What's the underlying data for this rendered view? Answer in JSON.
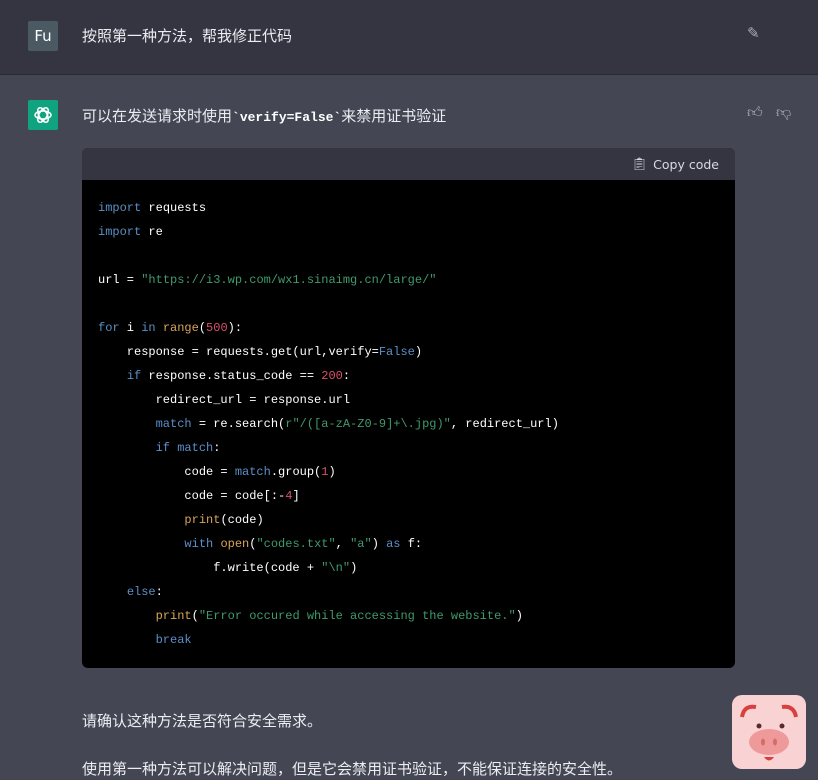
{
  "user": {
    "avatar": "Fu",
    "message": "按照第一种方法，帮我修正代码",
    "edit_icon": "edit-icon"
  },
  "assistant": {
    "intro_before": "可以在发送请求时使用",
    "intro_code": "`verify=False`",
    "intro_after": "来禁用证书验证",
    "thumbs_up": "thumbs-up-icon",
    "thumbs_down": "thumbs-down-icon",
    "para1": "请确认这种方法是否符合安全需求。",
    "para2": "使用第一种方法可以解决问题，但是它会禁用证书验证，不能保证连接的安全性。"
  },
  "code": {
    "copy_label": "Copy code",
    "colors": {
      "keyword": "#5b8fc7",
      "builtin": "#d8a55a",
      "number": "#d9506b",
      "string": "#3f9a6e"
    },
    "lines": [
      [
        [
          "k",
          "import"
        ],
        [
          "p",
          " requests"
        ]
      ],
      [
        [
          "k",
          "import"
        ],
        [
          "p",
          " re"
        ]
      ],
      [],
      [
        [
          "p",
          "url = "
        ],
        [
          "s",
          "\"https://i3.wp.com/wx1.sinaimg.cn/large/\""
        ]
      ],
      [],
      [
        [
          "k",
          "for"
        ],
        [
          "p",
          " i "
        ],
        [
          "k",
          "in"
        ],
        [
          "p",
          " "
        ],
        [
          "f",
          "range"
        ],
        [
          "p",
          "("
        ],
        [
          "n",
          "500"
        ],
        [
          "p",
          "):"
        ]
      ],
      [
        [
          "p",
          "    response = requests.get(url,verify="
        ],
        [
          "k",
          "False"
        ],
        [
          "p",
          ")"
        ]
      ],
      [
        [
          "p",
          "    "
        ],
        [
          "k",
          "if"
        ],
        [
          "p",
          " response.status_code == "
        ],
        [
          "n",
          "200"
        ],
        [
          "p",
          ":"
        ]
      ],
      [
        [
          "p",
          "        redirect_url = response.url"
        ]
      ],
      [
        [
          "p",
          "        "
        ],
        [
          "k",
          "match"
        ],
        [
          "p",
          " = re.search("
        ],
        [
          "s",
          "r\"/([a-zA-Z0-9]+\\.jpg)\""
        ],
        [
          "p",
          ", redirect_url)"
        ]
      ],
      [
        [
          "p",
          "        "
        ],
        [
          "k",
          "if match"
        ],
        [
          "p",
          ":"
        ]
      ],
      [
        [
          "p",
          "            code = "
        ],
        [
          "k",
          "match"
        ],
        [
          "p",
          ".group("
        ],
        [
          "n",
          "1"
        ],
        [
          "p",
          ")"
        ]
      ],
      [
        [
          "p",
          "            code = code[:-"
        ],
        [
          "n",
          "4"
        ],
        [
          "p",
          "]"
        ]
      ],
      [
        [
          "p",
          "            "
        ],
        [
          "f",
          "print"
        ],
        [
          "p",
          "(code)"
        ]
      ],
      [
        [
          "p",
          "            "
        ],
        [
          "k",
          "with"
        ],
        [
          "p",
          " "
        ],
        [
          "f",
          "open"
        ],
        [
          "p",
          "("
        ],
        [
          "s",
          "\"codes.txt\""
        ],
        [
          "p",
          ", "
        ],
        [
          "s",
          "\"a\""
        ],
        [
          "p",
          ") "
        ],
        [
          "k",
          "as"
        ],
        [
          "p",
          " f:"
        ]
      ],
      [
        [
          "p",
          "                f.write(code + "
        ],
        [
          "s",
          "\"\\n\""
        ],
        [
          "p",
          ")"
        ]
      ],
      [
        [
          "p",
          "    "
        ],
        [
          "k",
          "else"
        ],
        [
          "p",
          ":"
        ]
      ],
      [
        [
          "p",
          "        "
        ],
        [
          "f",
          "print"
        ],
        [
          "p",
          "("
        ],
        [
          "s",
          "\"Error occured while accessing the website.\""
        ],
        [
          "p",
          ")"
        ]
      ],
      [
        [
          "p",
          "        "
        ],
        [
          "k",
          "break"
        ]
      ]
    ]
  }
}
